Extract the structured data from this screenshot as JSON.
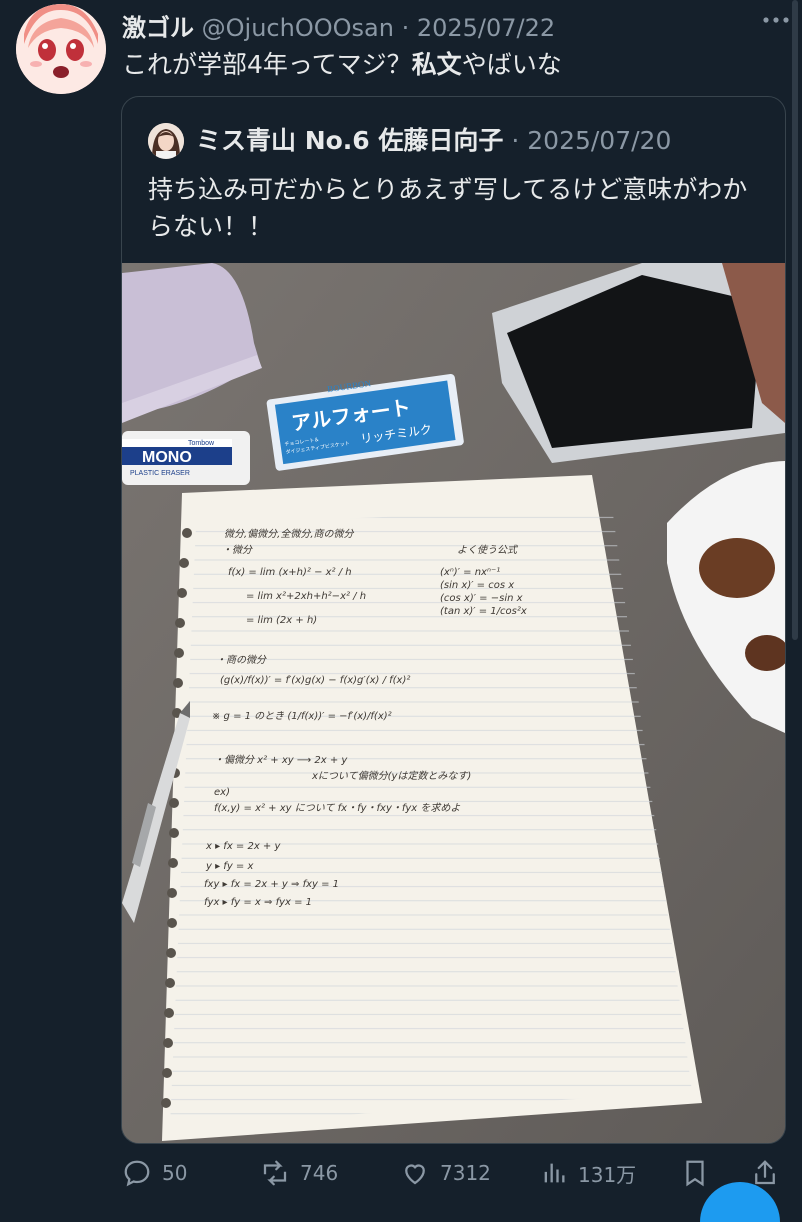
{
  "post": {
    "display_name": "激ゴル",
    "handle": "@OjuchOOOsan",
    "dot": "·",
    "date": "2025/07/22",
    "text_prefix": "これが学部4年ってマジ？",
    "text_bold": "私文",
    "text_suffix": "やばいな"
  },
  "quoted": {
    "display_name": "ミス青山 No.6 佐藤日向子",
    "dot": "·",
    "date": "2025/07/20",
    "text": "持ち込み可だからとりあえず写してるけど意味がわからない！！",
    "photo": {
      "snack_brand": "BOURBON",
      "snack_name": "アルフォート",
      "snack_flavor": "リッチミルク",
      "snack_desc1": "チョコレート＆",
      "snack_desc2": "ダイジェスティブビスケット",
      "eraser_label": "MONO",
      "eraser_brand": "Tombow",
      "eraser_sub": "PLASTIC ERASER",
      "notes": [
        "微分,偏微分,全微分,商の微分",
        "・微分",
        "f(x) = lim (x+h)² − x² / h",
        "= lim x²+2xh+h²−x² / h",
        "= lim (2x + h)",
        "よく使う公式",
        "(xⁿ)′ = nxⁿ⁻¹",
        "(sin x)′ = cos x",
        "(cos x)′ = −sin x",
        "(tan x)′ = 1/cos²x",
        "・商の微分",
        "(g(x)/f(x))′ = f′(x)g(x) − f(x)g′(x) / f(x)²",
        "※ g = 1 のとき (1/f(x))′ = −f′(x)/f(x)²",
        "・偏微分   x² + xy ⟶ 2x + y",
        "xについて偏微分(yは定数とみなす)",
        "ex)",
        "f(x,y) = x² + xy について fx・fy・fxy・fyx を求めよ",
        "x ▸ fx = 2x + y",
        "y ▸ fy = x",
        "fxy ▸ fx = 2x + y ⇒ fxy = 1",
        "fyx ▸ fy = x ⇒ fyx = 1"
      ]
    }
  },
  "actions": {
    "replies": "50",
    "reposts": "746",
    "likes": "7312",
    "views": "131万"
  },
  "icons": [
    "more-icon",
    "reply-icon",
    "repost-icon",
    "like-icon",
    "views-icon",
    "bookmark-icon",
    "share-icon"
  ],
  "colors": {
    "background": "#15202b",
    "text": "#e7e9ea",
    "muted": "#8b98a5",
    "border": "#38444d"
  }
}
